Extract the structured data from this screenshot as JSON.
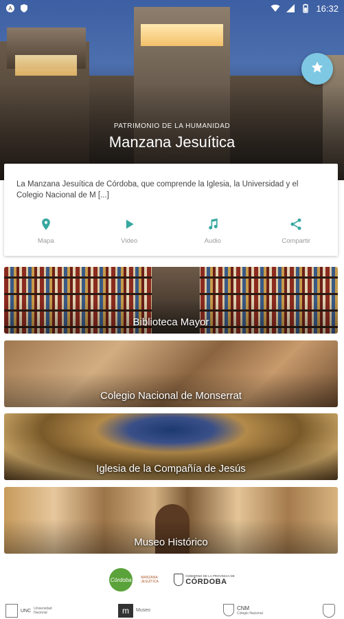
{
  "status_bar": {
    "time": "16:32",
    "icons": [
      "notification-a-icon",
      "shield-icon",
      "wifi-icon",
      "signal-icon",
      "battery-icon"
    ]
  },
  "hero": {
    "subtitle": "PATRIMONIO DE LA HUMANIDAD",
    "title": "Manzana Jesuítica",
    "favorite_icon": "star-icon",
    "accent_color": "#7ec8e3"
  },
  "card": {
    "description": "La Manzana Jesuítica de Córdoba, que comprende la Iglesia, la Universidad y el Colegio Nacional de M [...]",
    "actions": [
      {
        "label": "Mapa",
        "icon": "map-pin-icon"
      },
      {
        "label": "Video",
        "icon": "play-icon"
      },
      {
        "label": "Audio",
        "icon": "music-note-icon"
      },
      {
        "label": "Compartir",
        "icon": "share-icon"
      }
    ],
    "action_color": "#37a8a0"
  },
  "places": [
    {
      "title": "Biblioteca Mayor"
    },
    {
      "title": "Colegio Nacional de Monserrat"
    },
    {
      "title": "Iglesia de la Compañía de Jesús"
    },
    {
      "title": "Museo Histórico"
    }
  ],
  "logos": {
    "row1": {
      "circle": "Córdoba",
      "middle": "MANZANA JESUÍTICA",
      "gov_small": "GOBIERNO DE LA PROVINCIA DE",
      "gov_big": "CÓRDOBA"
    },
    "row2": {
      "unc": "UNC",
      "unc_sub": "Universidad Nacional",
      "museo": "Museo",
      "cnm": "CNM",
      "cnm_sub": "Colegio Nacional"
    }
  }
}
